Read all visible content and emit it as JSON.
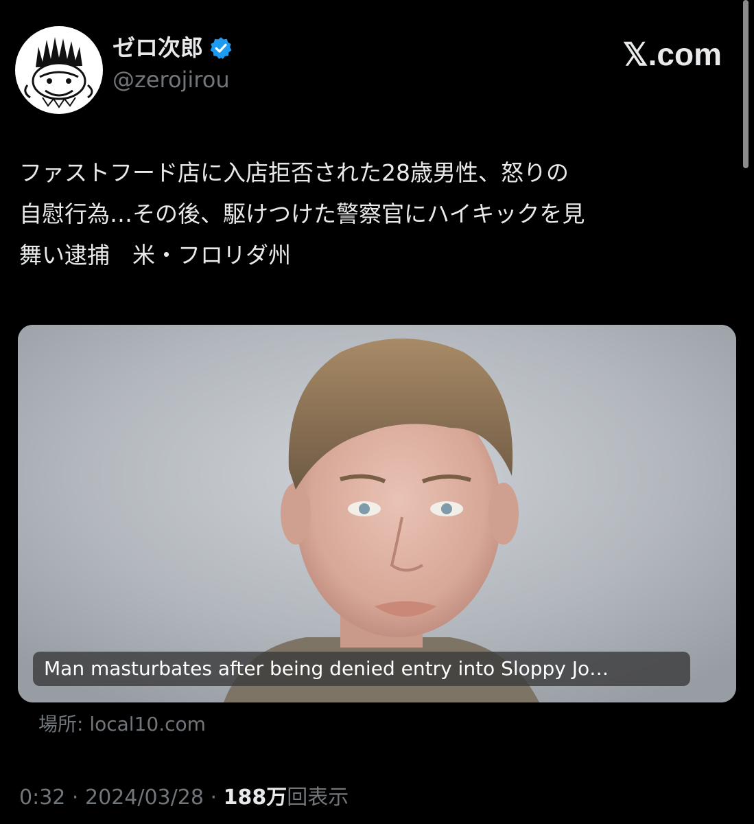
{
  "tweet": {
    "author": {
      "display_name": "ゼロ次郎",
      "handle": "@zerojirou",
      "verified_icon": "verified-badge-icon",
      "avatar_icon": "cartoon-avatar"
    },
    "brand": {
      "domain": "𝕏.com",
      "logo_icon": "x-logo-icon"
    },
    "text": "ファストフード店に入店拒否された28歳男性、怒りの\n自慰行為…その後、駆けつけた警察官にハイキックを見\n舞い逮捕　米・フロリダ州",
    "card": {
      "title": "Man masturbates after being denied entry into Sloppy Jo…",
      "source": "場所: local10.com"
    },
    "meta": {
      "time": "0:32",
      "separator": "·",
      "date": "2024/03/28",
      "views_count": "188万",
      "views_label": "回表示"
    }
  },
  "colors": {
    "background": "#000000",
    "text_primary": "#e7e9ea",
    "text_secondary": "#71767b",
    "verified_blue": "#1d9bf0"
  }
}
